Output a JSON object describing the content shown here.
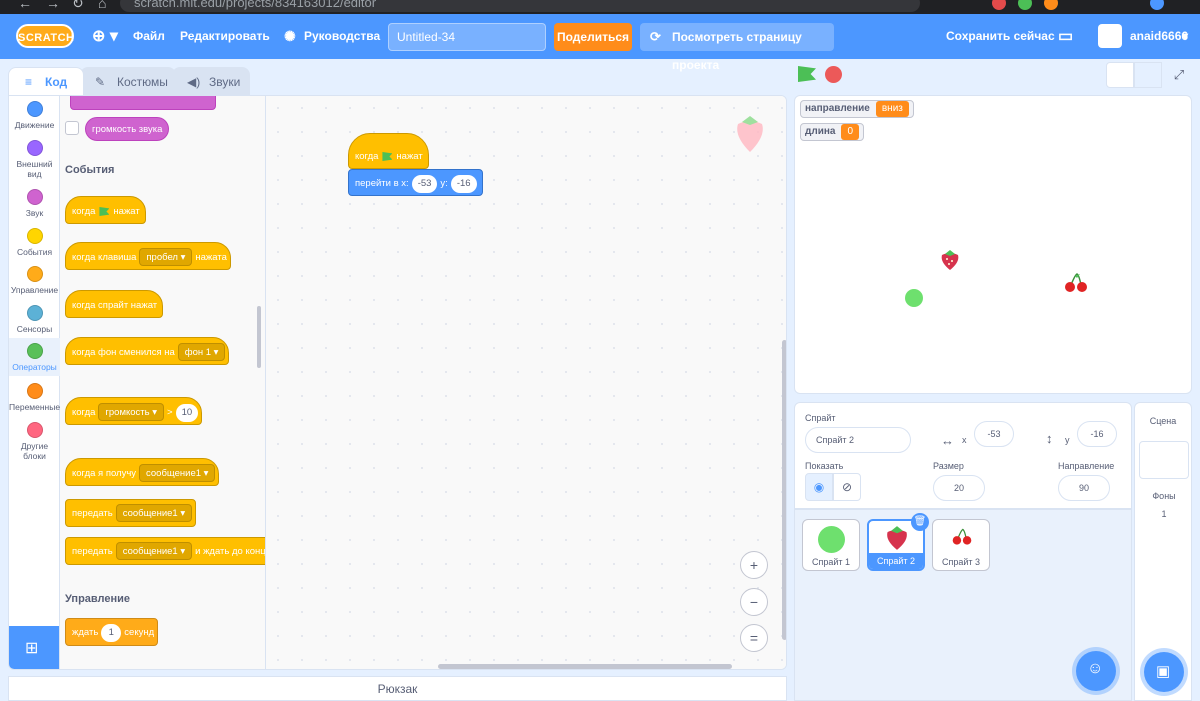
{
  "browser": {
    "url": "scratch.mit.edu/projects/834163012/editor"
  },
  "menubar": {
    "logo": "SCRATCH",
    "file": "Файл",
    "edit": "Редактировать",
    "tutorials": "Руководства",
    "project_title": "Untitled-34",
    "share": "Поделиться",
    "see_project": "Посмотреть страницу проекта",
    "save_now": "Сохранить сейчас",
    "username": "anaid6666"
  },
  "tabs": {
    "code": "Код",
    "costumes": "Костюмы",
    "sounds": "Звуки"
  },
  "categories": [
    {
      "label": "Движение",
      "color": "#4c97ff"
    },
    {
      "label": "Внешний вид",
      "color": "#9966ff"
    },
    {
      "label": "Звук",
      "color": "#cf63cf"
    },
    {
      "label": "События",
      "color": "#ffd500"
    },
    {
      "label": "Управление",
      "color": "#ffab19"
    },
    {
      "label": "Сенсоры",
      "color": "#5cb1d6"
    },
    {
      "label": "Операторы",
      "color": "#59c059"
    },
    {
      "label": "Переменные",
      "color": "#ff8c1a"
    },
    {
      "label": "Другие блоки",
      "color": "#ff6680"
    }
  ],
  "flyout": {
    "volume_reporter": "громкость звука",
    "events_header": "События",
    "when_flag": "когда",
    "clicked": "нажат",
    "when_key_pre": "когда клавиша",
    "key": "пробел",
    "when_key_post": "нажата",
    "when_sprite": "когда спрайт нажат",
    "when_backdrop": "когда фон сменился на",
    "backdrop": "фон 1",
    "when_gt_pre": "когда",
    "loudness": "громкость",
    "gt": ">",
    "gt_value": "10",
    "when_receive": "когда я получу",
    "message": "сообщение1",
    "broadcast": "передать",
    "broadcast_wait_post": "и ждать до конца",
    "control_header": "Управление",
    "wait": "ждать",
    "wait_value": "1",
    "seconds": "секунд"
  },
  "script": {
    "when": "когда",
    "clicked": "нажат",
    "goto": "перейти в x:",
    "x": "-53",
    "y_label": "y:",
    "y": "-16"
  },
  "zoom": {
    "in": "+",
    "out": "−",
    "reset": "="
  },
  "backpack": "Рюкзак",
  "stage": {
    "monitors": [
      {
        "label": "направление",
        "value": "вниз"
      },
      {
        "label": "длина",
        "value": "0"
      }
    ]
  },
  "sprite_info": {
    "sprite_label": "Спрайт",
    "sprite_name": "Спрайт 2",
    "x_label": "x",
    "x": "-53",
    "y_label": "y",
    "y": "-16",
    "show_label": "Показать",
    "size_label": "Размер",
    "size": "20",
    "direction_label": "Направление",
    "direction": "90"
  },
  "sprites": [
    {
      "name": "Спрайт 1"
    },
    {
      "name": "Спрайт 2"
    },
    {
      "name": "Спрайт 3"
    }
  ],
  "stage_pane": {
    "title": "Сцена",
    "backdrops_label": "Фоны",
    "backdrops_count": "1"
  },
  "colors": {
    "accent": "#4c97ff",
    "events": "#ffbf00",
    "control": "#ffab19",
    "motion": "#4c97ff",
    "sound": "#cf63cf",
    "share": "#ff8c1a"
  }
}
